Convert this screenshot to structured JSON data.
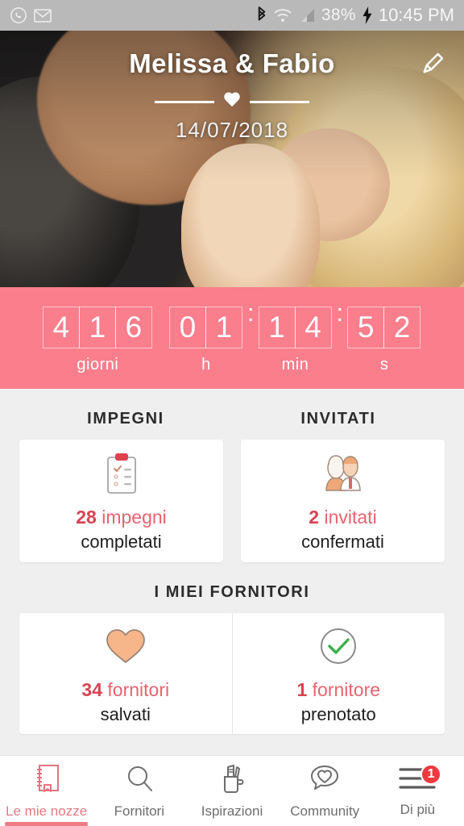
{
  "statusbar": {
    "icons_left": [
      "whatsapp-icon",
      "email-icon"
    ],
    "bluetooth": "bluetooth-icon",
    "wifi": "wifi-icon",
    "signal": "signal-icon",
    "battery_percent": "38%",
    "charging": "charging-bolt-icon",
    "clock": "10:45 PM"
  },
  "hero": {
    "couple_names": "Melissa & Fabio",
    "wedding_date": "14/07/2018",
    "edit_icon": "pencil-edit-icon",
    "heart_divider_icon": "heart-icon"
  },
  "countdown": {
    "background_color": "#fa7e8c",
    "days": [
      "4",
      "1",
      "6"
    ],
    "days_label": "giorni",
    "hours": [
      "0",
      "1"
    ],
    "hours_label": "h",
    "minutes": [
      "1",
      "4"
    ],
    "minutes_label": "min",
    "seconds": [
      "5",
      "2"
    ],
    "seconds_label": "s",
    "separator": ":"
  },
  "sections": {
    "impegni_title": "IMPEGNI",
    "invitati_title": "INVITATI",
    "fornitori_title": "I MIEI FORNITORI"
  },
  "cards": {
    "impegni": {
      "icon": "clipboard-checklist-icon",
      "count": "28",
      "unit": "impegni",
      "status": "completati"
    },
    "invitati": {
      "icon": "couple-guests-icon",
      "count": "2",
      "unit": "invitati",
      "status": "confermati"
    },
    "fornitori_salvati": {
      "icon": "heart-icon",
      "icon_color": "#f7b58a",
      "count": "34",
      "unit": "fornitori",
      "status": "salvati"
    },
    "fornitori_prenotati": {
      "icon": "check-circle-icon",
      "icon_color": "#3aaf4a",
      "count": "1",
      "unit": "fornitore",
      "status": "prenotato"
    }
  },
  "bottom_nav": {
    "items": [
      {
        "label": "Le mie nozze",
        "icon": "notebook-icon",
        "active": true
      },
      {
        "label": "Fornitori",
        "icon": "search-icon",
        "active": false
      },
      {
        "label": "Ispirazioni",
        "icon": "pencil-cup-icon",
        "active": false
      },
      {
        "label": "Community",
        "icon": "chat-heart-icon",
        "active": false
      },
      {
        "label": "Di più",
        "icon": "hamburger-menu-icon",
        "active": false,
        "badge": "1"
      }
    ]
  },
  "colors": {
    "accent_pink": "#fa7e8c",
    "accent_red": "#d64452",
    "text_pink": "#e9636f",
    "background": "#efefef"
  }
}
